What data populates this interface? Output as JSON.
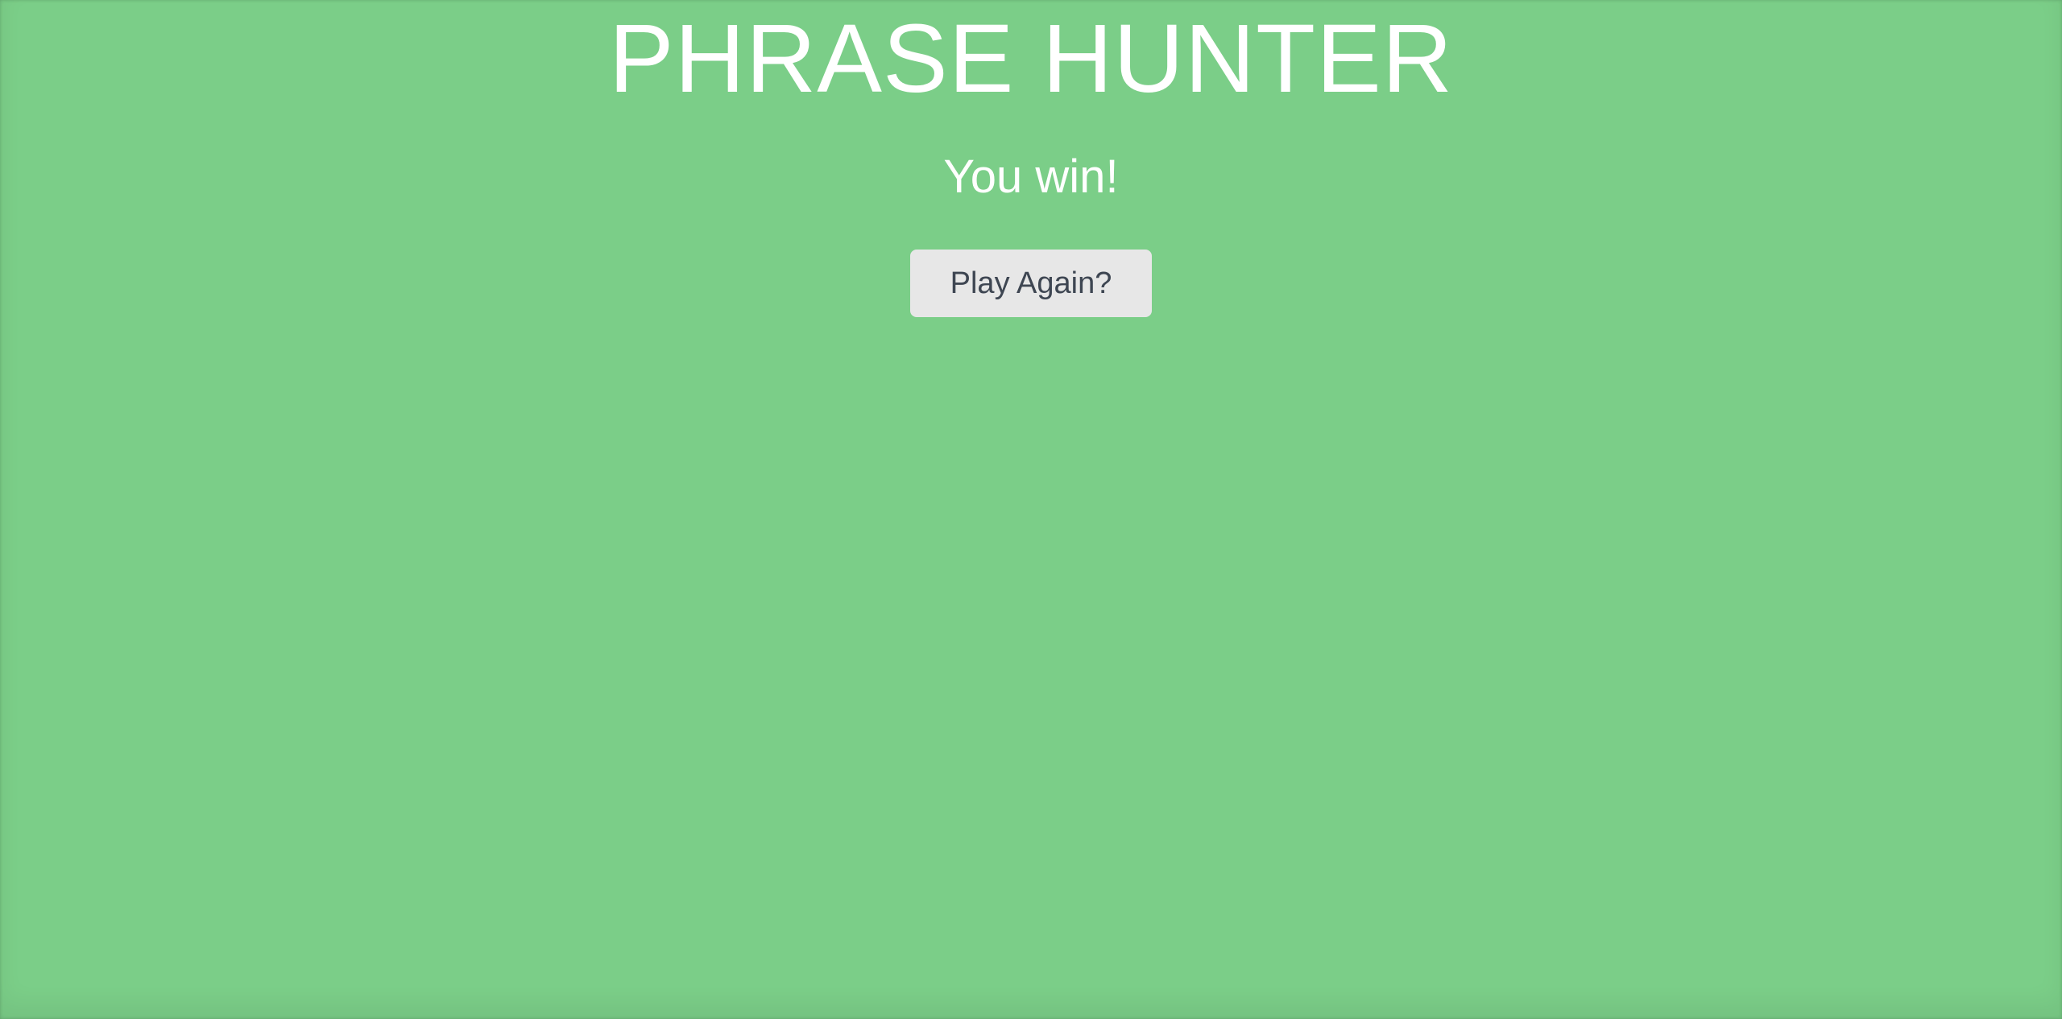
{
  "game": {
    "title": "PHRASE HUNTER",
    "message": "You win!",
    "reset_button_label": "Play Again?"
  },
  "colors": {
    "overlay_win": "#7bce88",
    "text": "#ffffff",
    "button_bg": "#e7e7e7",
    "button_text": "#3e4652"
  }
}
